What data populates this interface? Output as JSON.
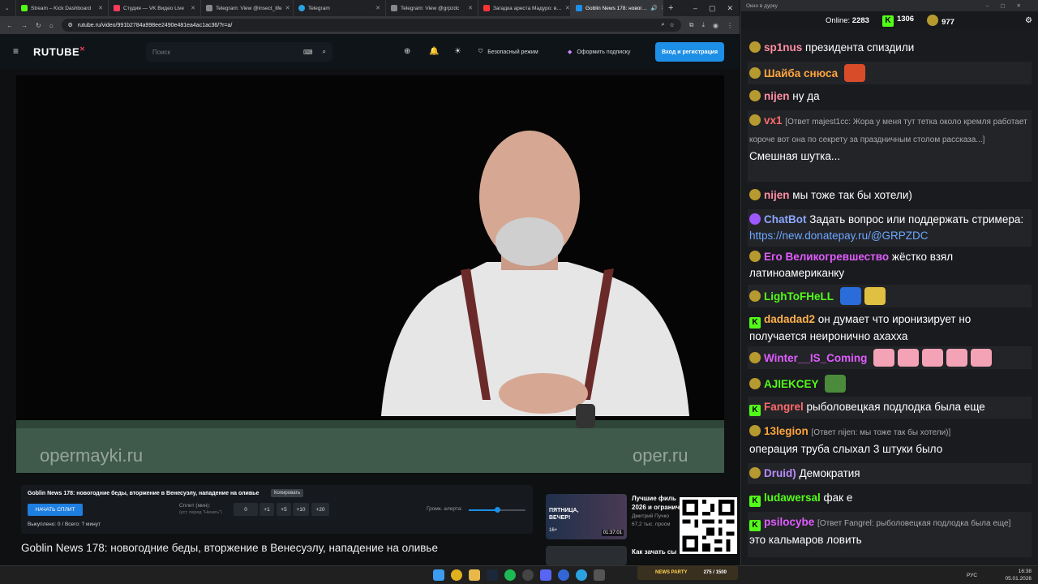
{
  "browser": {
    "tabs": [
      {
        "label": "Stream – Kick Dashboard",
        "color": "#53fc18"
      },
      {
        "label": "Студия — VK Видео Live",
        "color": "#ff3a5c"
      },
      {
        "label": "Telegram: View @insect_life",
        "color": "#888888"
      },
      {
        "label": "Telegram",
        "color": "#2aa3e0"
      },
      {
        "label": "Telegram: View @grpzdc",
        "color": "#888888"
      },
      {
        "label": "Загадка ареста Мадуро: в…",
        "color": "#ff3333"
      },
      {
        "label": "Goblin News 178: новог…",
        "color": "#1e8fe6",
        "active": true
      }
    ],
    "url": "rutube.ru/video/991b2784a998ee2490e481ea4ac1ac36/?r=a/"
  },
  "rutube": {
    "logo": "RUTUBE",
    "search_placeholder": "Поиск",
    "safe_mode": "Безопасный режим",
    "subscribe": "Оформить подписку",
    "login": "Вход и регистрация"
  },
  "video": {
    "watermark_left": "opermayki.ru",
    "watermark_right": "oper.ru"
  },
  "panel": {
    "title": "Goblin News 178: новогодние беды, вторжение в Венесуэлу, нападение на оливье",
    "copy": "Копировать",
    "split_button": "НАЧАТЬ СПЛИТ",
    "split_label": "Сплит (мин):",
    "split_sub": "(уст. перед \"Начать\")",
    "steps": [
      "0",
      "+1",
      "+5",
      "+10",
      "+20"
    ],
    "volume_label": "Громк. алерта:",
    "volume_level": 0.5,
    "bought": "Выкуплено: 0 / Всего: ? минут"
  },
  "video_title": "Goblin News 178: новогодние беды, вторжение в Венесуэлу, нападение на оливье",
  "recommendations": [
    {
      "title": "Лучшие филь",
      "title2": "2026 и огранич",
      "meta": "Дмитрий Пучко",
      "meta2": "67,2 тыс. просм",
      "duration": "01:37:01",
      "badge": "16+",
      "thumb_text": "ПЯТНИЦА, ВЕЧЕР!"
    },
    {
      "title": "Как зачать сы",
      "title2": "",
      "meta": "",
      "meta2": "",
      "duration": "",
      "badge": "",
      "thumb_text": ""
    }
  ],
  "chat": {
    "window_title": "Окно в дурку",
    "online_label": "Online:",
    "online": "2283",
    "kick_count": "1306",
    "vk_count": "977",
    "messages": [
      {
        "user": "sp1nus",
        "color": "#ff8fa3",
        "text": "президента спиздили",
        "badge": "g"
      },
      {
        "user": "Шайба снюса",
        "color": "#ffa53d",
        "text": "",
        "badge": "g"
      },
      {
        "user": "nijen",
        "color": "#ff8fa3",
        "text": "ну да",
        "badge": "g"
      },
      {
        "user": "vx1",
        "color": "#ff6b6b",
        "reply": "[Ответ majest1cc: Жора у меня тут тетка около кремля работает короче вот она по секрету за праздничным столом рассказа...]",
        "text": "Смешная шутка...",
        "badge": "g"
      },
      {
        "user": "nijen",
        "color": "#ff8fa3",
        "text": "мы тоже так бы хотели)",
        "badge": "g"
      },
      {
        "user": "ChatBot",
        "color": "#8ca8ff",
        "text": "Задать вопрос или поддержать стримера:",
        "link": "https://new.donatepay.ru/@GRPZDC",
        "badge": "bot"
      },
      {
        "user": "Его Великогревшество",
        "color": "#e05cff",
        "text": "жёстко взял латиноамериканку",
        "badge": "g"
      },
      {
        "user": "LighToFHeLL",
        "color": "#53fc18",
        "text": "",
        "badge": "g"
      },
      {
        "user": "dadadad2",
        "color": "#ffb24d",
        "text": "он думает что иронизирует но получается неиронично ахахха",
        "badge": "k"
      },
      {
        "user": "Winter__IS_Coming",
        "color": "#e05cff",
        "text": "",
        "badge": "g"
      },
      {
        "user": "AJIEKCEY",
        "color": "#53fc18",
        "text": "",
        "badge": "g"
      },
      {
        "user": "Fangrel",
        "color": "#ff6b6b",
        "text": "рыболовецкая подлодка была еще",
        "badge": "k"
      },
      {
        "user": "13legion",
        "color": "#ffa53d",
        "reply": "[Ответ nijen: мы тоже так бы хотели)]",
        "text": "операция труба слыхал 3 штуки было",
        "badge": "g"
      },
      {
        "user": "Druid)",
        "color": "#b88cff",
        "text": "Демократия",
        "badge": "g"
      },
      {
        "user": "ludawersal",
        "color": "#53fc18",
        "text": "фак е",
        "badge": "k"
      },
      {
        "user": "psilocybe",
        "color": "#e05cff",
        "reply": "[Ответ Fangrel: рыболовецкая подлодка была еще]",
        "text": "это кальмаров ловить",
        "badge": "k"
      }
    ]
  },
  "taskbar": {
    "lang": "РУС",
    "time": "16:38",
    "date": "05.01.2026",
    "news_party": "NEWS PARTY",
    "news_party_count": "275 / 1500"
  },
  "colors": {
    "accent": "#1e8fe6",
    "kick": "#53fc18",
    "rutube_red": "#ff3a5c"
  }
}
